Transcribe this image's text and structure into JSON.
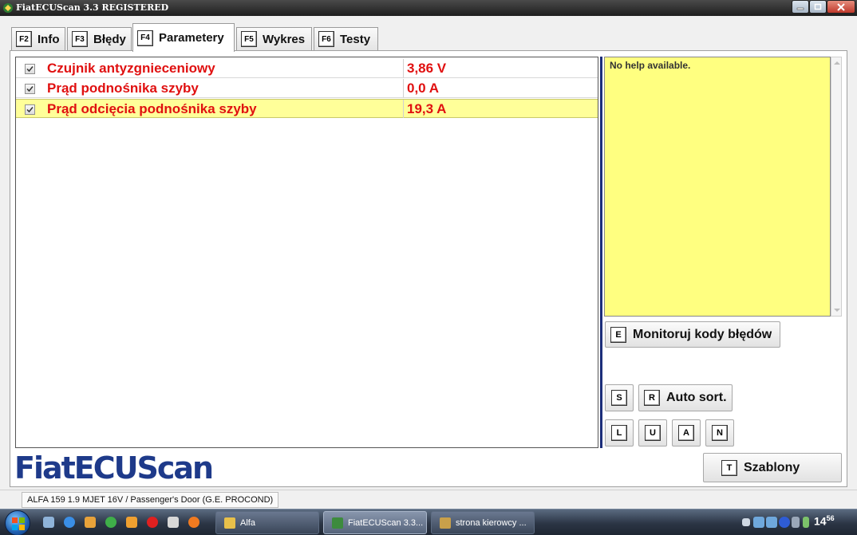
{
  "window": {
    "title": "FiatECUScan 3.3 REGISTERED"
  },
  "tabs": [
    {
      "key": "F2",
      "label": "Info"
    },
    {
      "key": "F3",
      "label": "Błędy"
    },
    {
      "key": "F4",
      "label": "Parametery"
    },
    {
      "key": "F5",
      "label": "Wykres"
    },
    {
      "key": "F6",
      "label": "Testy"
    }
  ],
  "active_tab": "Parametery",
  "parameters": [
    {
      "name": "Czujnik antyzgnieceniowy",
      "value": "3,86 V",
      "checked": true
    },
    {
      "name": "Prąd podnośnika szyby",
      "value": "0,0 A",
      "checked": true
    },
    {
      "name": "Prąd odcięcia podnośnika szyby",
      "value": "19,3 A",
      "checked": true
    }
  ],
  "selected_row": 3,
  "help": {
    "text": "No help available."
  },
  "buttons": {
    "monitor": {
      "key": "E",
      "label": "Monitoruj kody błędów"
    },
    "s": {
      "key": "S"
    },
    "autosort": {
      "key": "R",
      "label": "Auto sort."
    },
    "l": {
      "key": "L"
    },
    "u": {
      "key": "U"
    },
    "a": {
      "key": "A"
    },
    "n": {
      "key": "N"
    },
    "templates": {
      "key": "T",
      "label": "Szablony"
    }
  },
  "logo": "FiatECUScan",
  "status": {
    "text": "ALFA 159 1.9 MJET 16V / Passenger's Door (G.E. PROCOND)"
  },
  "taskbar": {
    "tasks": [
      {
        "label": "Alfa",
        "icon": "folder-icon"
      },
      {
        "label": "FiatECUScan 3.3...",
        "icon": "fiatecuscan-icon",
        "active": true
      },
      {
        "label": "strona kierowcy ...",
        "icon": "paint-icon"
      }
    ],
    "clock_hour": "14",
    "clock_min": "56"
  },
  "colors": {
    "param_text": "#e01010",
    "selection": "#ffff99",
    "help_bg": "#ffff80",
    "logo": "#1e3a8a",
    "splitter": "#1c2e7a"
  }
}
